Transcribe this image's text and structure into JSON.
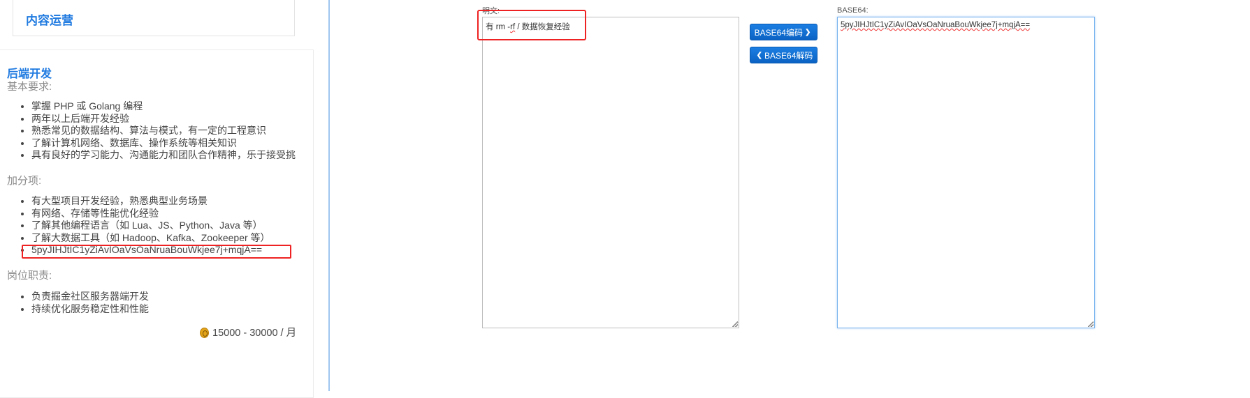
{
  "top_card": {
    "title": "内容运营"
  },
  "job": {
    "title": "后端开发",
    "requirements_heading": "基本要求:",
    "requirements": [
      "掌握 PHP 或 Golang 编程",
      "两年以上后端开发经验",
      "熟悉常见的数据结构、算法与模式，有一定的工程意识",
      "了解计算机网络、数据库、操作系统等相关知识",
      "具有良好的学习能力、沟通能力和团队合作精神，乐于接受挑"
    ],
    "bonus_heading": "加分项:",
    "bonus": [
      "有大型项目开发经验，熟悉典型业务场景",
      "有网络、存储等性能优化经验",
      "了解其他编程语言（如 Lua、JS、Python、Java 等）",
      "了解大数据工具（如 Hadoop、Kafka、Zookeeper 等）",
      "5pyJIHJtIC1yZiAvIOaVsOaNruaBouWkjee7j+mqjA=="
    ],
    "duties_heading": "岗位职责:",
    "duties": [
      "负责掘金社区服务器端开发",
      "持续优化服务稳定性和性能"
    ],
    "salary": "15000 - 30000 / 月",
    "salary_icon": "money-bag-icon"
  },
  "encoder": {
    "plain_label": "明文:",
    "plain_value": "有 rm -rf / 数据恢复经验",
    "encode_button": "BASE64编码",
    "decode_button": "BASE64解码",
    "b64_label": "BASE64:",
    "b64_value": "5pyJIHJtIC1yZiAvIOaVsOaNruaBouWkjee7j+mqjA=="
  },
  "colors": {
    "accent": "#1f7ae0",
    "button": "#0b63c4",
    "highlight": "#e22222"
  }
}
